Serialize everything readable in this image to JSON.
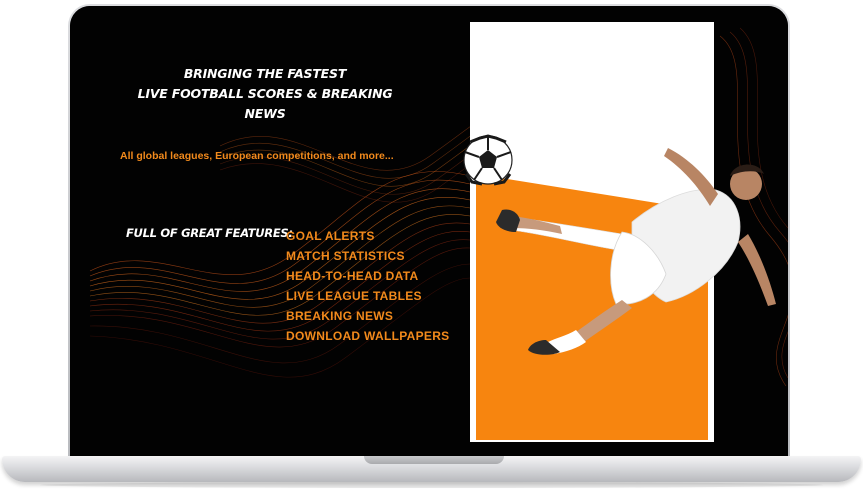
{
  "headline": {
    "line1": "Bringing the fastest",
    "line2": "live football scores & breaking news"
  },
  "subline": "All global leagues, European competitions, and more...",
  "features": {
    "label": "Full of great features:",
    "items": [
      "GOAL ALERTS",
      "MATCH STATISTICS",
      "HEAD-TO-HEAD DATA",
      "LIVE LEAGUE TABLES",
      "BREAKING NEWS",
      "DOWNLOAD WALLPAPERS"
    ]
  },
  "colors": {
    "accent": "#f28a1c",
    "panel_orange": "#f7850f",
    "screen_bg": "#020202"
  }
}
